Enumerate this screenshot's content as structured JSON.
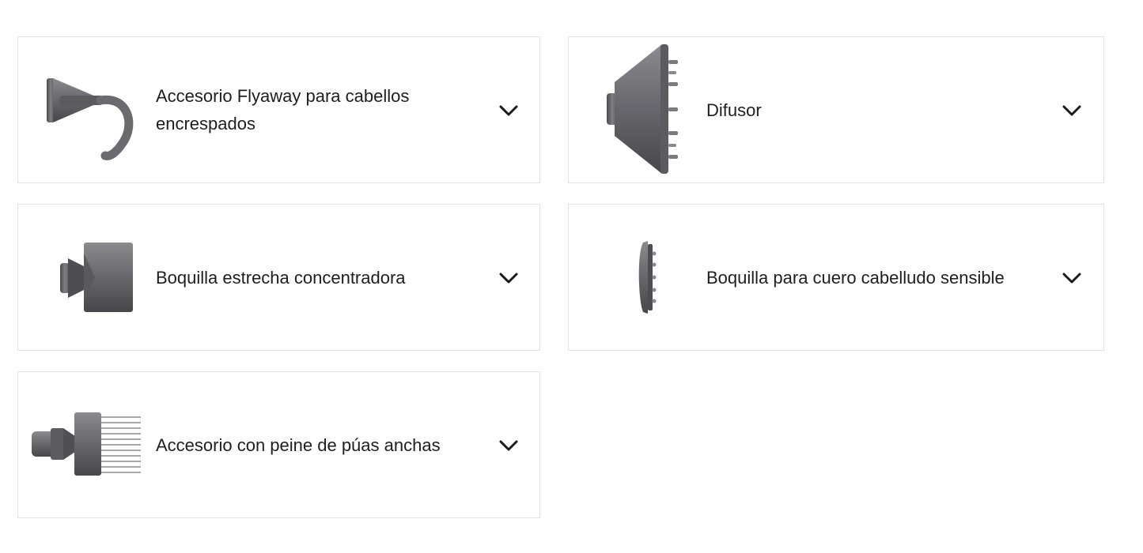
{
  "accessories": [
    {
      "label": "Accesorio Flyaway para cabellos encrespados",
      "icon": "flyaway-attachment-icon"
    },
    {
      "label": "Difusor",
      "icon": "diffuser-icon"
    },
    {
      "label": "Boquilla estrecha concentradora",
      "icon": "concentrator-nozzle-icon"
    },
    {
      "label": "Boquilla para cuero cabelludo sensible",
      "icon": "gentle-air-nozzle-icon"
    },
    {
      "label": "Accesorio con peine de púas anchas",
      "icon": "wide-tooth-comb-icon"
    }
  ],
  "colors": {
    "border": "#e3e3e3",
    "text": "#1e1e1e",
    "metal": "#6e6e73"
  },
  "chevron_icon": "chevron-down-icon"
}
